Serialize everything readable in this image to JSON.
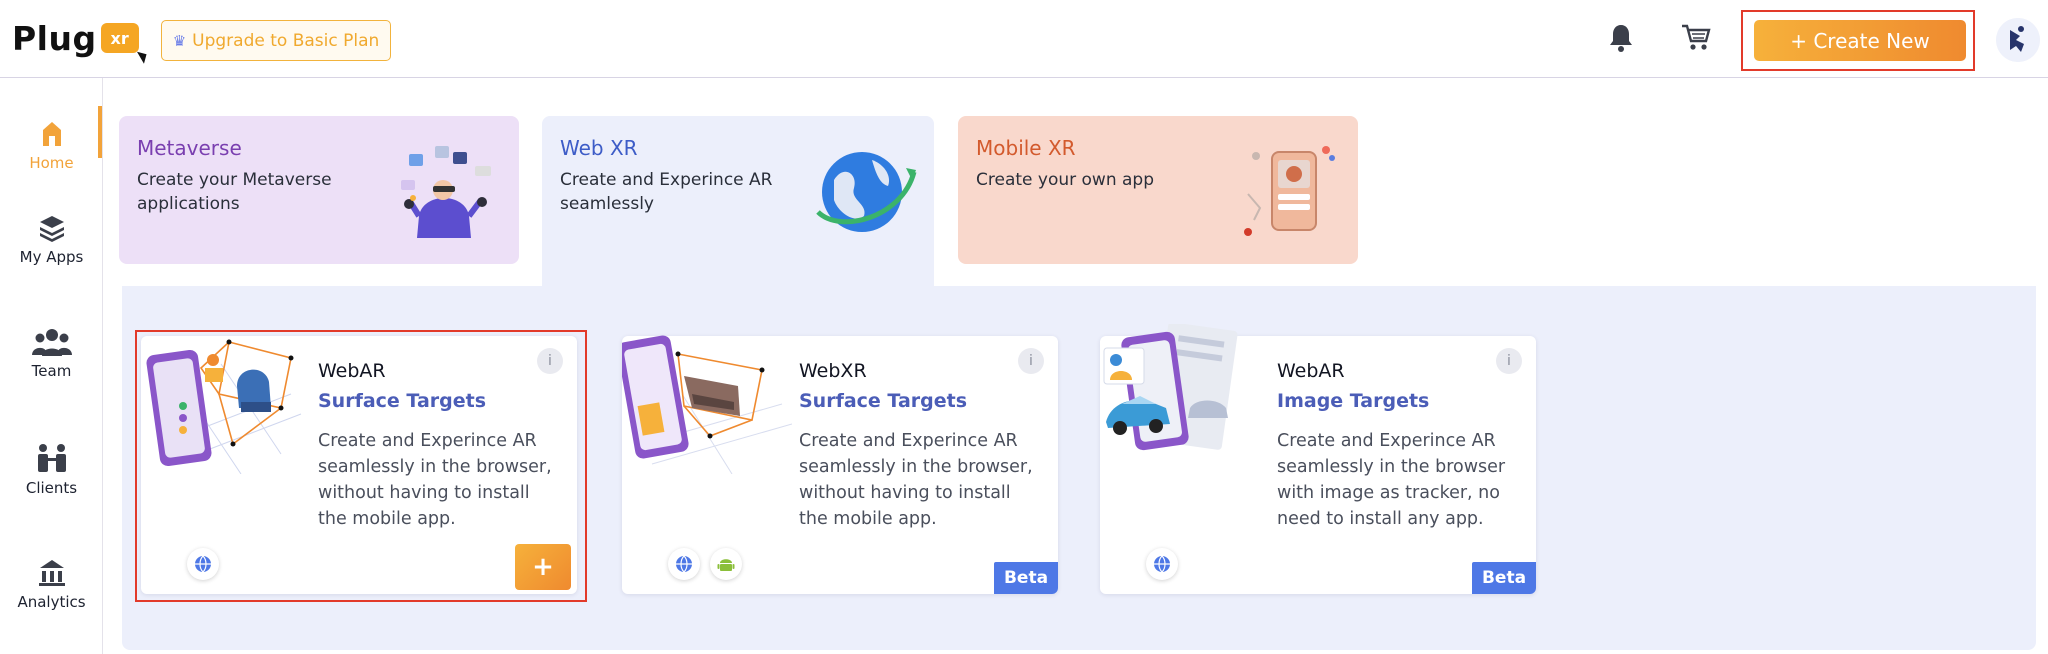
{
  "header": {
    "logo_text": "Plug",
    "logo_badge": "xr",
    "upgrade_label": "Upgrade to Basic Plan",
    "create_label": "+ Create New"
  },
  "sidebar": {
    "items": [
      {
        "label": "Home",
        "icon": "home-icon",
        "active": true
      },
      {
        "label": "My Apps",
        "icon": "layers-icon"
      },
      {
        "label": "Team",
        "icon": "team-icon"
      },
      {
        "label": "Clients",
        "icon": "clients-icon"
      },
      {
        "label": "Analytics",
        "icon": "analytics-icon"
      }
    ]
  },
  "tabs": [
    {
      "title": "Metaverse",
      "desc": "Create your Metaverse applications"
    },
    {
      "title": "Web XR",
      "desc": "Create and Experince AR seamlessly"
    },
    {
      "title": "Mobile XR",
      "desc": "Create your own app"
    }
  ],
  "cards": [
    {
      "type": "WebAR",
      "subtitle": "Surface Targets",
      "desc": "Create and Experince AR seamlessly in the browser, without having to install the mobile app.",
      "platforms": [
        "web"
      ],
      "action": "+",
      "badge": ""
    },
    {
      "type": "WebXR",
      "subtitle": "Surface Targets",
      "desc": "Create and Experince AR seamlessly in the browser, without having to install the mobile app.",
      "platforms": [
        "web",
        "android"
      ],
      "badge": "Beta"
    },
    {
      "type": "WebAR",
      "subtitle": "Image Targets",
      "desc": "Create and Experince AR seamlessly in the browser with image as tracker, no need to install any app.",
      "platforms": [
        "web"
      ],
      "badge": "Beta"
    }
  ],
  "info_glyph": "i",
  "colors": {
    "accent": "#f2a33a",
    "beta": "#4e78e6",
    "highlight": "#e23a2a",
    "panel": "#eceffb"
  }
}
